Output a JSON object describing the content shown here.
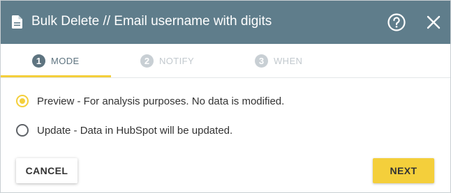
{
  "dialog": {
    "title": "Bulk Delete // Email username with digits",
    "help_icon": "help-circle-icon",
    "close_icon": "close-icon",
    "doc_icon": "document-icon"
  },
  "steps": [
    {
      "number": "1",
      "label": "MODE",
      "active": true
    },
    {
      "number": "2",
      "label": "NOTIFY",
      "active": false
    },
    {
      "number": "3",
      "label": "WHEN",
      "active": false
    }
  ],
  "options": [
    {
      "label": "Preview - For analysis purposes. No data is modified.",
      "selected": true
    },
    {
      "label": "Update - Data in HubSpot will be updated.",
      "selected": false
    }
  ],
  "buttons": {
    "cancel_label": "CANCEL",
    "next_label": "NEXT"
  },
  "colors": {
    "header": "#5f7d8b",
    "accent": "#f4cf3b",
    "step_active": "#5e7480",
    "step_inactive": "#c8cfd4"
  }
}
